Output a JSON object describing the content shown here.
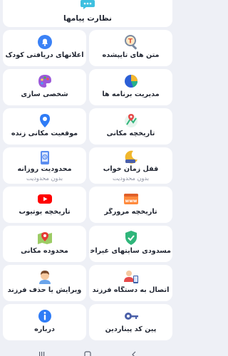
{
  "top": {
    "label": "نظارت پیامها",
    "icon": "chat-bubble-icon"
  },
  "grid": [
    [
      {
        "name": "keyboard-notifications",
        "label": "اعلانهای دریافتی کودک",
        "icon": "bell-icon"
      },
      {
        "name": "typed-text",
        "label": "متن های تایپشده",
        "icon": "typing-magnifier-icon"
      }
    ],
    [
      {
        "name": "personalize",
        "label": "شخصی سازی",
        "icon": "palette-icon"
      },
      {
        "name": "app-management",
        "label": "مدیریت برنامه ها",
        "icon": "pie-chart-icon"
      }
    ],
    [
      {
        "name": "live-location",
        "label": "موقعیت مکانی زنده",
        "icon": "location-pin-icon"
      },
      {
        "name": "location-history",
        "label": "تاریخچه مکانی",
        "icon": "map-history-icon"
      }
    ],
    [
      {
        "name": "daily-limit",
        "label": "محدودیت روزانه",
        "sub": "بدون محدودیت",
        "icon": "phone-limit-icon"
      },
      {
        "name": "bedtime-lock",
        "label": "قفل زمان خواب",
        "sub": "بدون محدودیت",
        "icon": "moon-bed-icon"
      }
    ],
    [
      {
        "name": "youtube-history",
        "label": "تاریخچه یوتیوب",
        "icon": "youtube-icon"
      },
      {
        "name": "browser-history",
        "label": "تاریخچه مرورگر",
        "icon": "browser-www-icon"
      }
    ],
    [
      {
        "name": "geofence",
        "label": "محدوده مکانی",
        "icon": "map-area-icon"
      },
      {
        "name": "block-immoral-sites",
        "label": "مسدودی سایتهای غیراخلاقی",
        "icon": "shield-check-icon"
      }
    ],
    [
      {
        "name": "edit-remove-child",
        "label": "ویرایش یا حذف فرزند",
        "icon": "child-avatar-icon"
      },
      {
        "name": "connect-child-device",
        "label": "اتصال به دستگاه فرزند",
        "icon": "person-device-icon"
      }
    ],
    [
      {
        "name": "about",
        "label": "درباره",
        "icon": "info-icon"
      },
      {
        "name": "pin-code",
        "label": "پین کد پیناردین",
        "icon": "key-icon"
      }
    ]
  ],
  "colors": {
    "background": "#eef0f6",
    "tile": "#ffffff",
    "text": "#1f2430",
    "subtext": "#8b90a0"
  }
}
